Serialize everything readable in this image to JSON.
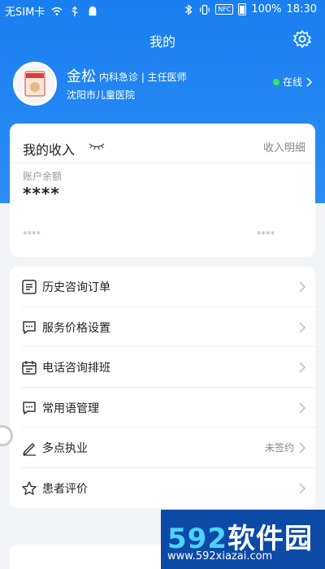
{
  "status_bar": {
    "carrier": "无SIM卡",
    "nfc": "NFC",
    "battery": "100%",
    "time": "18:30"
  },
  "header": {
    "title": "我的"
  },
  "profile": {
    "name": "金松",
    "dept": "内科急诊 | 主任医师",
    "hospital": "沈阳市儿童医院",
    "status": "在线"
  },
  "income": {
    "title": "我的收入",
    "detail": "收入明细",
    "balance_label": "账户余额",
    "balance": "****",
    "sub_left": "****",
    "sub_right": "****"
  },
  "menu": [
    {
      "label": "历史咨询订单",
      "icon": "order-list-icon",
      "value": ""
    },
    {
      "label": "服务价格设置",
      "icon": "chat-bubble-icon",
      "value": ""
    },
    {
      "label": "电话咨询排班",
      "icon": "calendar-icon",
      "value": ""
    },
    {
      "label": "常用语管理",
      "icon": "chat-bubble-icon",
      "value": ""
    },
    {
      "label": "多点执业",
      "icon": "pen-icon",
      "value": "未签约"
    },
    {
      "label": "患者评价",
      "icon": "star-icon",
      "value": ""
    }
  ],
  "watermark": {
    "brand_num": "592",
    "brand_text": "软件园",
    "url": "www.592xiazai.com"
  },
  "colors": {
    "primary": "#1a7ff0",
    "online": "#3be35c"
  }
}
